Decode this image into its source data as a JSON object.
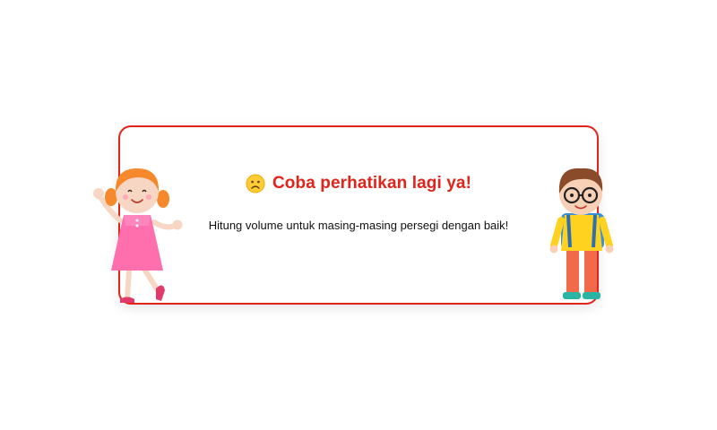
{
  "feedback": {
    "title": "Coba perhatikan lagi ya!",
    "message": "Hitung volume untuk masing-masing persegi dengan baik!",
    "emoji": "frowning-face-icon"
  },
  "characters": {
    "left": "girl-illustration",
    "right": "boy-illustration"
  },
  "colors": {
    "accent": "#e2231a",
    "background": "#ffffff",
    "text": "#111111"
  }
}
